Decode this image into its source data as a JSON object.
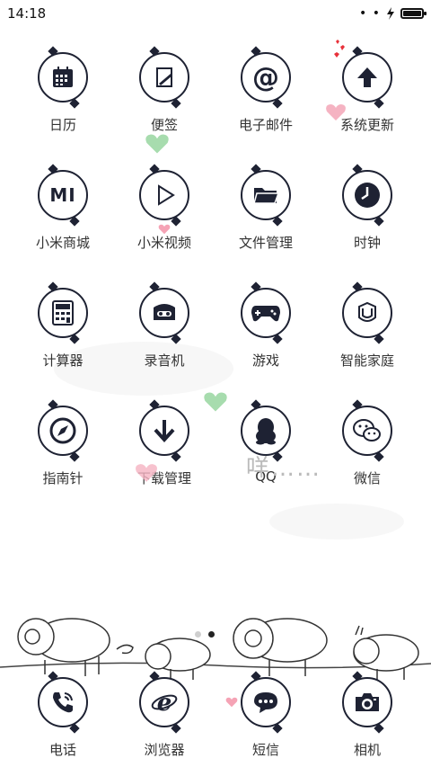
{
  "status_bar": {
    "time": "14:18",
    "dots": "• •"
  },
  "apps": [
    {
      "label": "日历",
      "icon": "calendar-icon"
    },
    {
      "label": "便签",
      "icon": "notes-icon"
    },
    {
      "label": "电子邮件",
      "icon": "email-at-icon"
    },
    {
      "label": "系统更新",
      "icon": "update-arrow-icon"
    },
    {
      "label": "小米商城",
      "icon": "mi-logo-icon"
    },
    {
      "label": "小米视频",
      "icon": "play-icon"
    },
    {
      "label": "文件管理",
      "icon": "folder-icon"
    },
    {
      "label": "时钟",
      "icon": "clock-icon"
    },
    {
      "label": "计算器",
      "icon": "calculator-icon"
    },
    {
      "label": "录音机",
      "icon": "recorder-icon"
    },
    {
      "label": "游戏",
      "icon": "gamepad-icon"
    },
    {
      "label": "智能家庭",
      "icon": "smart-home-icon"
    },
    {
      "label": "指南针",
      "icon": "compass-icon"
    },
    {
      "label": "下载管理",
      "icon": "download-icon"
    },
    {
      "label": "QQ",
      "icon": "qq-penguin-icon"
    },
    {
      "label": "微信",
      "icon": "wechat-icon"
    }
  ],
  "dock": [
    {
      "label": "电话",
      "icon": "phone-icon"
    },
    {
      "label": "浏览器",
      "icon": "browser-icon"
    },
    {
      "label": "短信",
      "icon": "message-icon"
    },
    {
      "label": "相机",
      "icon": "camera-icon"
    }
  ],
  "page_indicator": {
    "count": 2,
    "active_index": 1
  },
  "wallpaper_text": "咩……",
  "colors": {
    "outline": "#1e2233",
    "heart_pink": "#f5a3b5",
    "heart_green": "#a7dcae",
    "heart_red": "#e8313a"
  }
}
